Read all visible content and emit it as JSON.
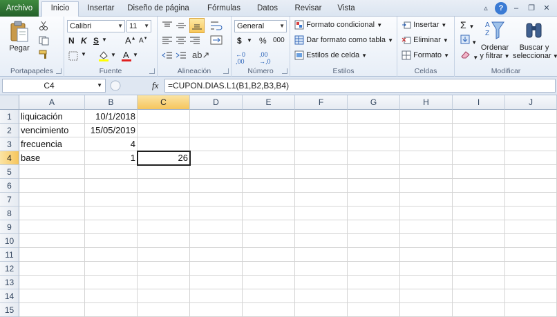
{
  "tabs": {
    "file": "Archivo",
    "items": [
      "Inicio",
      "Insertar",
      "Diseño de página",
      "Fórmulas",
      "Datos",
      "Revisar",
      "Vista"
    ],
    "active": "Inicio"
  },
  "ribbon": {
    "clipboard": {
      "paste": "Pegar",
      "label": "Portapapeles"
    },
    "font": {
      "name": "Calibri",
      "size": "11",
      "bold": "N",
      "italic": "K",
      "underline": "S",
      "label": "Fuente"
    },
    "alignment": {
      "label": "Alineación"
    },
    "number": {
      "format": "General",
      "currency": "$",
      "percent": "%",
      "thousands": "000",
      "label": "Número"
    },
    "styles": {
      "conditional": "Formato condicional",
      "table": "Dar formato como tabla",
      "cell": "Estilos de celda",
      "label": "Estilos"
    },
    "cells": {
      "insert": "Insertar",
      "delete": "Eliminar",
      "format": "Formato",
      "label": "Celdas"
    },
    "editing": {
      "sort_line1": "Ordenar",
      "sort_line2": "y filtrar",
      "find_line1": "Buscar y",
      "find_line2": "seleccionar",
      "label": "Modificar"
    }
  },
  "formula_bar": {
    "name_box": "C4",
    "fx": "fx",
    "formula": "=CUPON.DIAS.L1(B1,B2,B3,B4)"
  },
  "sheet": {
    "columns": [
      "A",
      "B",
      "C",
      "D",
      "E",
      "F",
      "G",
      "H",
      "I",
      "J"
    ],
    "rows": [
      "1",
      "2",
      "3",
      "4",
      "5",
      "6",
      "7",
      "8",
      "9",
      "10",
      "11",
      "12",
      "13",
      "14",
      "15"
    ],
    "selected_column": "C",
    "selected_row": "4",
    "cells": {
      "A1": "liquicación",
      "B1": "10/1/2018",
      "A2": "vencimiento",
      "B2": "15/05/2019",
      "A3": "frecuencia",
      "B3": "4",
      "A4": "base",
      "B4": "1",
      "C4": "26"
    }
  },
  "colors": {
    "accent": "#f6c55c",
    "file_tab": "#2f7a34",
    "grid_line": "#d4d4d4"
  }
}
